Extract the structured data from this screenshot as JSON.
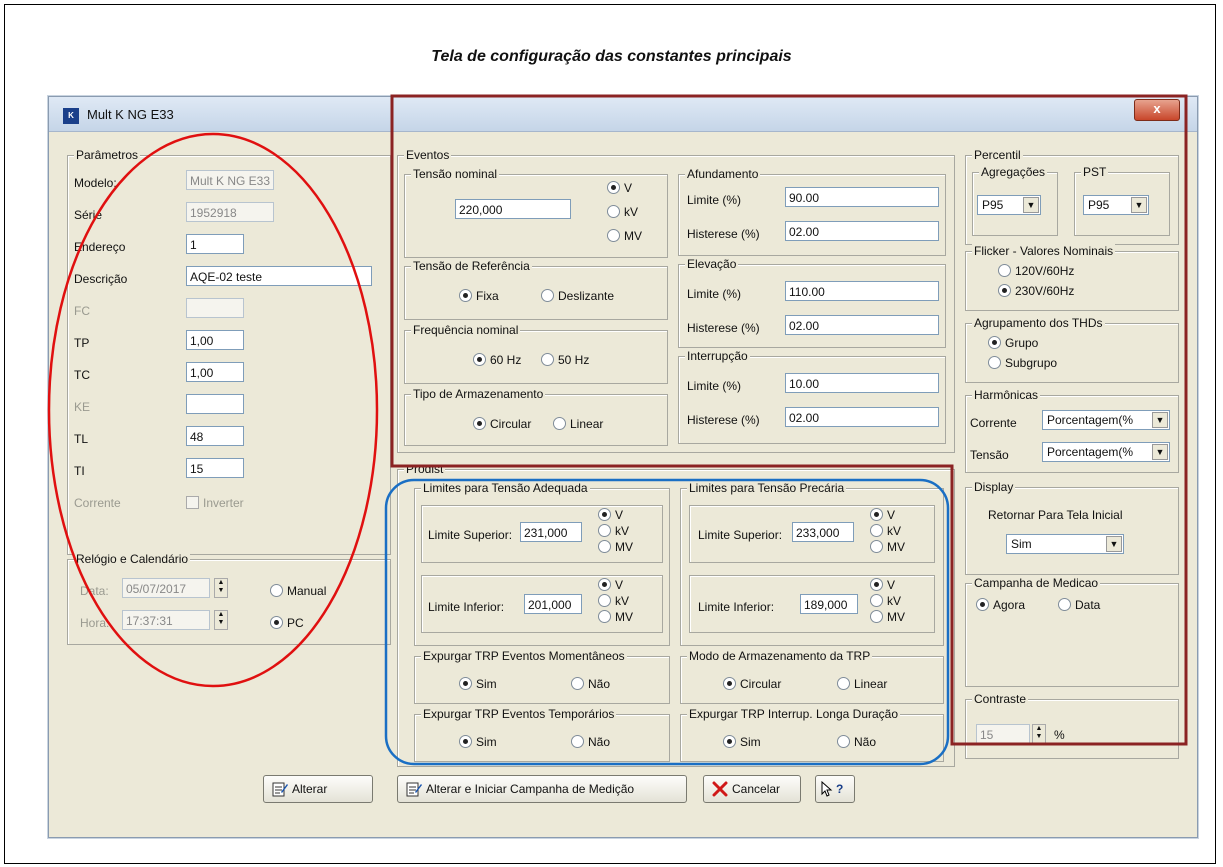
{
  "caption": "Tela de configuração das constantes principais",
  "window": {
    "title": "Mult K NG E33",
    "close_glyph": "x",
    "icon_text": "K"
  },
  "parametros": {
    "legend": "Parâmetros",
    "modelo_label": "Modelo:",
    "modelo_value": "Mult K NG E33",
    "serie_label": "Série",
    "serie_value": "1952918",
    "endereco_label": "Endereço",
    "endereco_value": "1",
    "descricao_label": "Descrição",
    "descricao_value": "AQE-02 teste",
    "fc_label": "FC",
    "fc_value": "",
    "tp_label": "TP",
    "tp_value": "1,00",
    "tc_label": "TC",
    "tc_value": "1,00",
    "ke_label": "KE",
    "ke_value": "",
    "tl_label": "TL",
    "tl_value": "48",
    "ti_label": "TI",
    "ti_value": "15",
    "corrente_label": "Corrente",
    "inverter_label": "Inverter"
  },
  "relogio": {
    "legend": "Relógio e Calendário",
    "data_label": "Data:",
    "data_value": "05/07/2017",
    "hora_label": "Hora:",
    "hora_value": "17:37:31",
    "manual_label": "Manual",
    "pc_label": "PC",
    "selected": "PC"
  },
  "eventos": {
    "legend": "Eventos",
    "tensao_nominal": {
      "legend": "Tensão nominal",
      "value": "220,000",
      "units": [
        "V",
        "kV",
        "MV"
      ],
      "selected": "V"
    },
    "tensao_referencia": {
      "legend": "Tensão de Referência",
      "fixa": "Fixa",
      "deslizante": "Deslizante",
      "selected": "Fixa"
    },
    "frequencia": {
      "legend": "Frequência nominal",
      "opt60": "60 Hz",
      "opt50": "50 Hz",
      "selected": "60 Hz"
    },
    "armazenamento": {
      "legend": "Tipo de Armazenamento",
      "circular": "Circular",
      "linear": "Linear",
      "selected": "Circular"
    },
    "afundamento": {
      "legend": "Afundamento",
      "limite_label": "Limite (%)",
      "limite": "90.00",
      "histerese_label": "Histerese (%)",
      "histerese": "02.00"
    },
    "elevacao": {
      "legend": "Elevação",
      "limite_label": "Limite (%)",
      "limite": "110.00",
      "histerese_label": "Histerese (%)",
      "histerese": "02.00"
    },
    "interrupcao": {
      "legend": "Interrupção",
      "limite_label": "Limite (%)",
      "limite": "10.00",
      "histerese_label": "Histerese (%)",
      "histerese": "02.00"
    }
  },
  "prodist": {
    "legend": "Prodist",
    "adequada": {
      "legend": "Limites para Tensão Adequada",
      "sup_label": "Limite Superior:",
      "sup_value": "231,000",
      "inf_label": "Limite Inferior:",
      "inf_value": "201,000"
    },
    "precaria": {
      "legend": "Limites para Tensão Precária",
      "sup_label": "Limite Superior:",
      "sup_value": "233,000",
      "inf_label": "Limite Inferior:",
      "inf_value": "189,000"
    },
    "units": [
      "V",
      "kV",
      "MV"
    ],
    "exp_momentaneos": {
      "legend": "Expurgar TRP Eventos Momentâneos",
      "sim": "Sim",
      "nao": "Não"
    },
    "modo_trp": {
      "legend": "Modo de Armazenamento da TRP",
      "circular": "Circular",
      "linear": "Linear"
    },
    "exp_temporarios": {
      "legend": "Expurgar TRP Eventos Temporários",
      "sim": "Sim",
      "nao": "Não"
    },
    "exp_longa": {
      "legend": "Expurgar TRP Interrup. Longa Duração",
      "sim": "Sim",
      "nao": "Não"
    }
  },
  "percentil": {
    "legend": "Percentil",
    "agregacoes_legend": "Agregações",
    "agregacoes_value": "P95",
    "pst_legend": "PST",
    "pst_value": "P95"
  },
  "flicker": {
    "legend": "Flicker - Valores Nominais",
    "opt1": "120V/60Hz",
    "opt2": "230V/60Hz",
    "selected": "230V/60Hz"
  },
  "thd": {
    "legend": "Agrupamento dos THDs",
    "opt1": "Grupo",
    "opt2": "Subgrupo",
    "selected": "Grupo"
  },
  "harmonicas": {
    "legend": "Harmônicas",
    "corrente_label": "Corrente",
    "corrente_value": "Porcentagem(%",
    "tensao_label": "Tensão",
    "tensao_value": "Porcentagem(%"
  },
  "display": {
    "legend": "Display",
    "retornar_label": "Retornar Para Tela Inicial",
    "value": "Sim"
  },
  "campanha": {
    "legend": "Campanha de Medicao",
    "agora": "Agora",
    "data": "Data",
    "selected": "Agora"
  },
  "contraste": {
    "legend": "Contraste",
    "value": "15",
    "unit": "%"
  },
  "buttons": {
    "alterar": "Alterar",
    "alterar_iniciar": "Alterar e Iniciar Campanha de Medição",
    "cancelar": "Cancelar",
    "help": "?"
  },
  "colors": {
    "red_annotation": "#e01010",
    "brown_annotation": "#8b2323",
    "blue_annotation": "#1a6fc4"
  }
}
